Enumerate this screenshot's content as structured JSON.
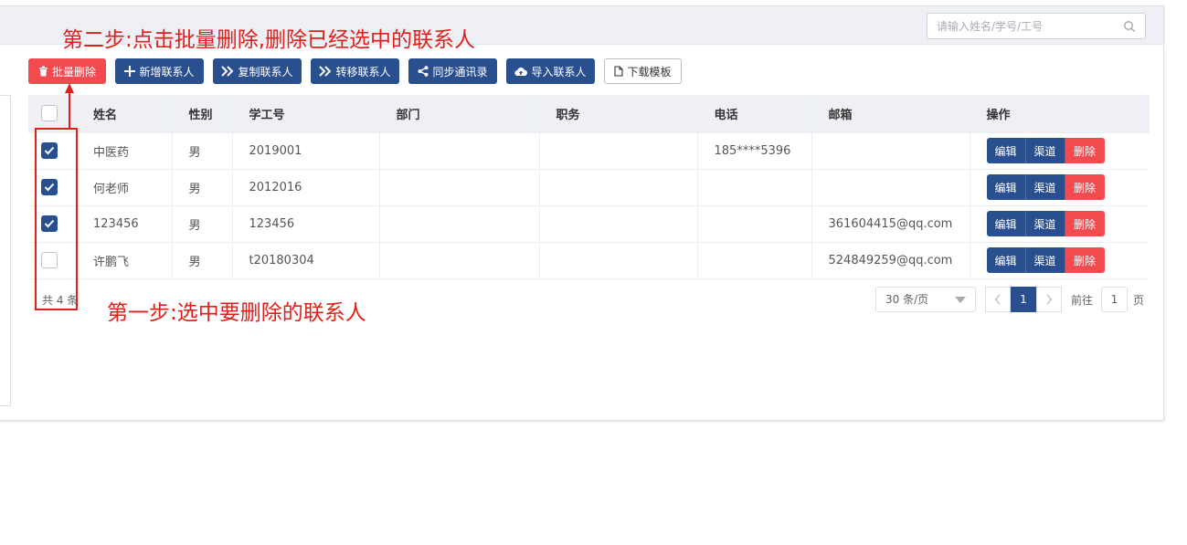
{
  "search": {
    "placeholder": "请输入姓名/学号/工号",
    "icon": "search-icon"
  },
  "toolbar": {
    "batch_delete": "批量删除",
    "add_contact": "新增联系人",
    "copy_contact": "复制联系人",
    "move_contact": "转移联系人",
    "sync_contacts": "同步通讯录",
    "import_contacts": "导入联系人",
    "download_template": "下载模板"
  },
  "table": {
    "headers": [
      "姓名",
      "性别",
      "学工号",
      "部门",
      "职务",
      "电话",
      "邮箱",
      "操作"
    ],
    "rows": [
      {
        "checked": true,
        "name": "中医药",
        "gender": "男",
        "id": "2019001",
        "dept": "",
        "title": "",
        "phone": "185****5396",
        "email": ""
      },
      {
        "checked": true,
        "name": "何老师",
        "gender": "男",
        "id": "2012016",
        "dept": "",
        "title": "",
        "phone": "",
        "email": ""
      },
      {
        "checked": true,
        "name": "123456",
        "gender": "男",
        "id": "123456",
        "dept": "",
        "title": "",
        "phone": "",
        "email": "361604415@qq.com"
      },
      {
        "checked": false,
        "name": "许鹏飞",
        "gender": "男",
        "id": "t20180304",
        "dept": "",
        "title": "",
        "phone": "",
        "email": "524849259@qq.com"
      }
    ],
    "ops": {
      "edit": "编辑",
      "channel": "渠道",
      "delete": "删除"
    }
  },
  "pagination": {
    "total": "共 4 条",
    "page_size": "30 条/页",
    "current_page": "1",
    "goto_label": "前往",
    "goto_value": "1",
    "goto_suffix": "页"
  },
  "annotations": {
    "step2": "第二步:点击批量删除,删除已经选中的联系人",
    "step1": "第一步:选中要删除的联系人"
  },
  "colors": {
    "primary": "#2a4f8f",
    "danger": "#f34a4f",
    "annotation": "#e0201b"
  }
}
